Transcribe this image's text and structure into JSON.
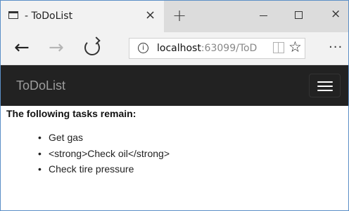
{
  "browser": {
    "tab_title": "- ToDoList",
    "tab_close": "×",
    "new_tab": "+",
    "window_controls": {
      "close": "×"
    },
    "nav": {
      "back": "←",
      "forward": "→"
    },
    "address": {
      "info": "i",
      "host": "localhost",
      "rest": ":63099/ToD"
    },
    "favorites_glyph": "☆",
    "more_glyph": "···"
  },
  "app": {
    "brand": "ToDoList"
  },
  "main": {
    "heading": "The following tasks remain:",
    "tasks": [
      "Get gas",
      "<strong>Check oil</strong>",
      "Check tire pressure"
    ]
  },
  "icons": [
    "tab-page-icon",
    "close-icon",
    "plus-icon",
    "minimize-icon",
    "maximize-icon",
    "back-arrow-icon",
    "forward-arrow-icon",
    "refresh-icon",
    "info-icon",
    "reading-view-icon",
    "star-icon",
    "more-icon",
    "hamburger-menu-icon"
  ],
  "colors": {
    "app_navbar": "#222222",
    "brand_text": "#9d9d9d",
    "browser_chrome": "#f2f2f2",
    "window_border": "#5b8fc7"
  }
}
